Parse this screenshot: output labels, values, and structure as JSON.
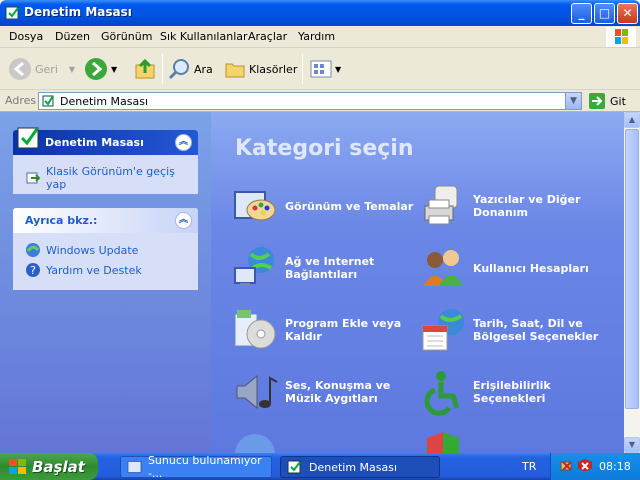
{
  "window": {
    "title": "Denetim Masası"
  },
  "menu": [
    "Dosya",
    "Düzen",
    "Görünüm",
    "Sık Kullanılanlar",
    "Araçlar",
    "Yardım"
  ],
  "toolbar": {
    "back": "Geri",
    "search": "Ara",
    "folders": "Klasörler"
  },
  "address": {
    "label": "Adres",
    "value": "Denetim Masası",
    "go": "Git"
  },
  "sidebar": {
    "panel1": {
      "title": "Denetim Masası",
      "link": "Klasik Görünüm'e geçiş yap"
    },
    "panel2": {
      "title": "Ayrıca bkz.:",
      "links": [
        "Windows Update",
        "Yardım ve Destek"
      ]
    }
  },
  "main": {
    "heading": "Kategori seçin",
    "categories": [
      {
        "label": "Görünüm ve Temalar",
        "icon": "appearance-icon"
      },
      {
        "label": "Yazıcılar ve Diğer Donanım",
        "icon": "printer-icon"
      },
      {
        "label": "Ağ ve Internet Bağlantıları",
        "icon": "network-icon"
      },
      {
        "label": "Kullanıcı Hesapları",
        "icon": "users-icon"
      },
      {
        "label": "Program Ekle veya Kaldır",
        "icon": "add-remove-icon"
      },
      {
        "label": "Tarih, Saat, Dil ve Bölgesel Seçenekler",
        "icon": "date-time-icon"
      },
      {
        "label": "Ses, Konuşma ve Müzik Aygıtları",
        "icon": "sound-icon"
      },
      {
        "label": "Erişilebilirlik Seçenekleri",
        "icon": "accessibility-icon"
      }
    ]
  },
  "taskbar": {
    "start": "Başlat",
    "tasks": [
      "Sunucu bulunamıyor -...",
      "Denetim Masası"
    ],
    "lang": "TR",
    "clock": "08:18"
  },
  "colors": {
    "titlebar": "#0054e3",
    "sidebar_link": "#215dc6",
    "main_bg": "#6a86e6",
    "start": "#2f8a2f"
  }
}
